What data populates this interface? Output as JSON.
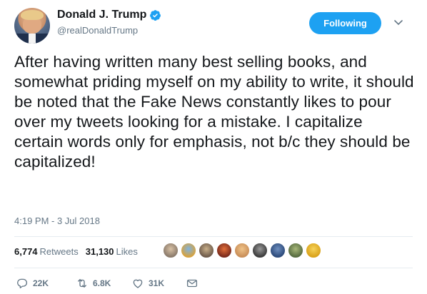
{
  "user": {
    "name": "Donald J. Trump",
    "handle": "@realDonaldTrump",
    "verified_icon": "verified-badge-icon",
    "verified_color": "#1da1f2"
  },
  "follow_button": {
    "label": "Following",
    "color": "#1da1f2"
  },
  "tweet": {
    "text": "After having written many best selling books, and somewhat priding myself on my ability to write, it should be noted that the Fake News constantly likes to pour over my tweets looking for a mistake. I capitalize certain words only for emphasis, not b/c they should be capitalized!",
    "timestamp": "4:19 PM - 3 Jul 2018"
  },
  "stats": {
    "retweets_count": "6,774",
    "retweets_label": "Retweets",
    "likes_count": "31,130",
    "likes_label": "Likes"
  },
  "likers": [
    {
      "icon": "liker-avatar-1",
      "color": "#8a7a6a"
    },
    {
      "icon": "liker-avatar-2",
      "color": "#d8a23c"
    },
    {
      "icon": "liker-avatar-3",
      "color": "#6d5a4a"
    },
    {
      "icon": "liker-avatar-4",
      "color": "#b5462e"
    },
    {
      "icon": "liker-avatar-5",
      "color": "#c98e58"
    },
    {
      "icon": "liker-avatar-6",
      "color": "#3b3b3b"
    },
    {
      "icon": "liker-avatar-7",
      "color": "#2c4a7a"
    },
    {
      "icon": "liker-avatar-8",
      "color": "#566b3f"
    },
    {
      "icon": "liker-avatar-9",
      "color": "#d9a21a"
    }
  ],
  "actions": {
    "reply_count": "22K",
    "retweet_count": "6.8K",
    "like_count": "31K"
  },
  "colors": {
    "text": "#14171a",
    "secondary": "#657786",
    "accent": "#1da1f2",
    "divider": "#e6ecf0"
  }
}
